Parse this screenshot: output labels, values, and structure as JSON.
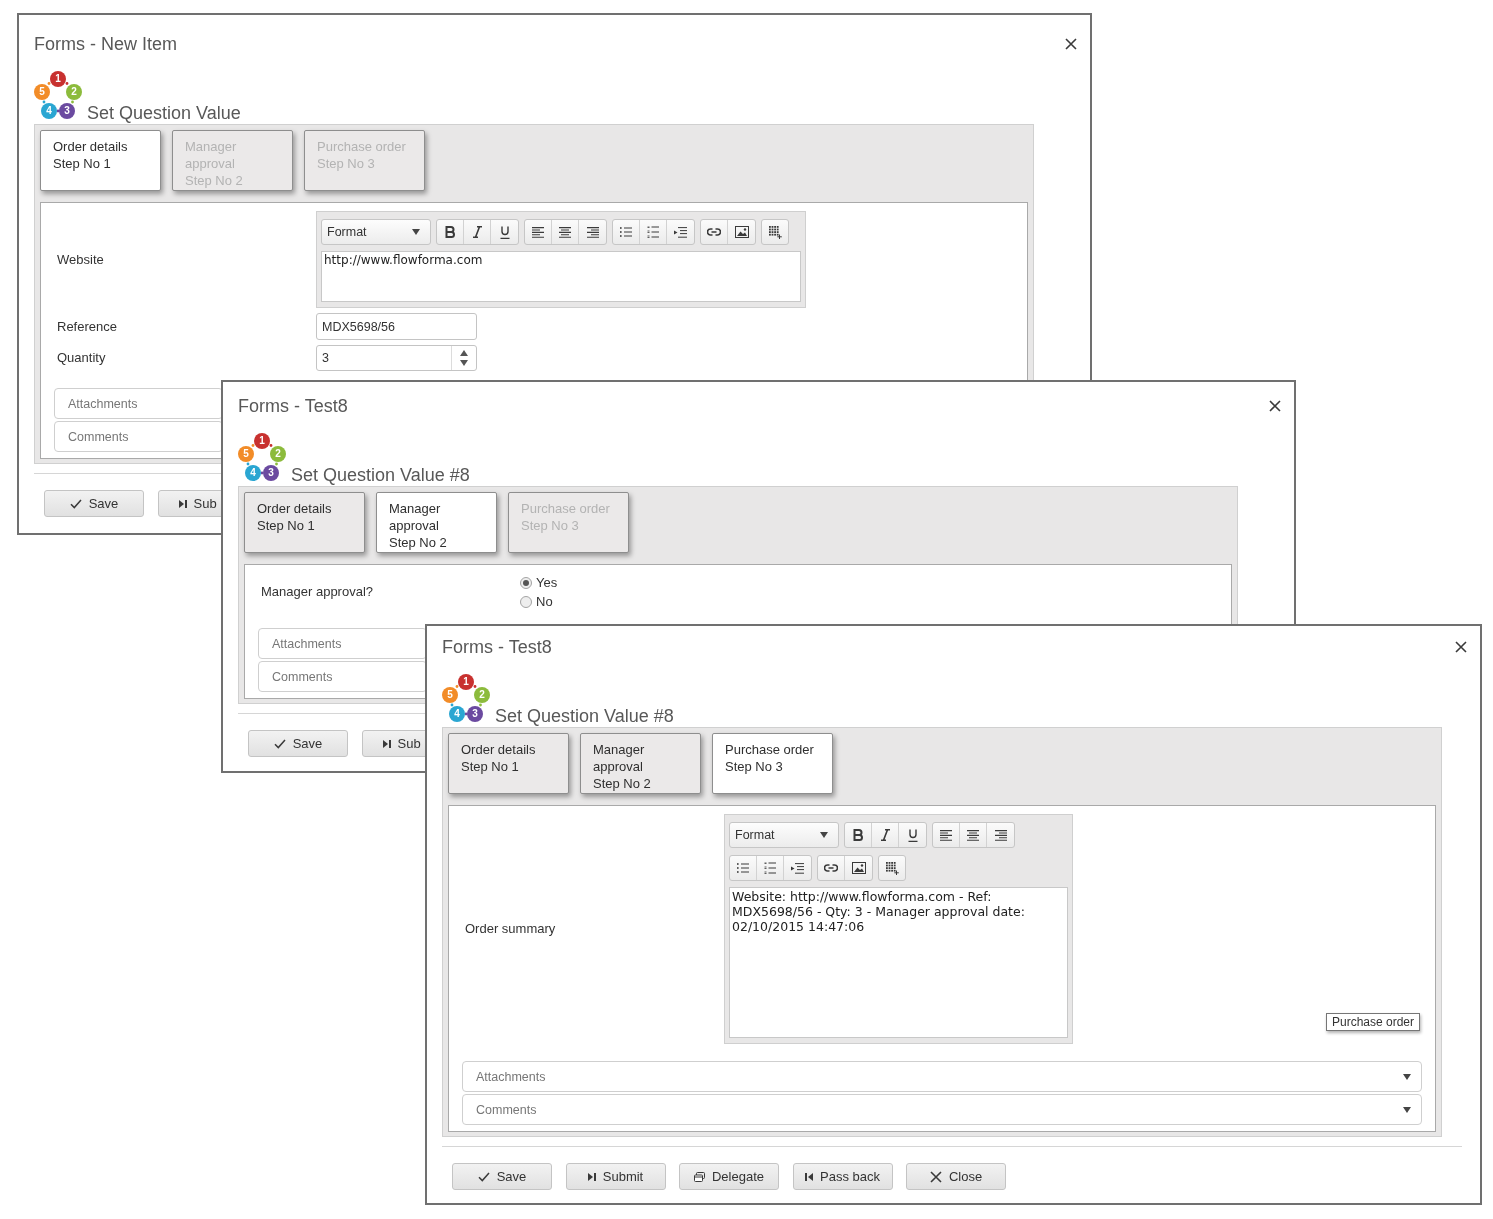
{
  "windows": [
    {
      "title": "Forms - New Item",
      "logo": [
        "1",
        "5",
        "2",
        "4",
        "3"
      ],
      "heading": "Set Question Value",
      "tabs": [
        {
          "label": "Order details",
          "step": "Step No 1",
          "selected": true,
          "disabled": false
        },
        {
          "label": "Manager approval",
          "step": "Step No 2",
          "selected": false,
          "disabled": true
        },
        {
          "label": "Purchase order",
          "step": "Step No 3",
          "selected": false,
          "disabled": true
        }
      ],
      "fields": [
        {
          "kind": "richtext",
          "label": "Website",
          "format": "Format",
          "value": "http://www.flowforma.com"
        },
        {
          "kind": "text",
          "label": "Reference",
          "value": "MDX5698/56"
        },
        {
          "kind": "number",
          "label": "Quantity",
          "value": "3"
        }
      ],
      "sections": [
        "Attachments",
        "Comments"
      ],
      "buttons": [
        {
          "kind": "save",
          "label": "Save"
        },
        {
          "kind": "submit",
          "label": "Sub"
        }
      ]
    },
    {
      "title": "Forms - Test8",
      "logo": [
        "1",
        "5",
        "2",
        "4",
        "3"
      ],
      "heading": "Set Question Value #8",
      "tabs": [
        {
          "label": "Order details",
          "step": "Step No 1",
          "selected": false,
          "disabled": false
        },
        {
          "label": "Manager approval",
          "step": "Step No 2",
          "selected": true,
          "disabled": false
        },
        {
          "label": "Purchase order",
          "step": "Step No 3",
          "selected": false,
          "disabled": true
        }
      ],
      "fields": [
        {
          "kind": "radio",
          "label": "Manager approval?",
          "options": [
            {
              "label": "Yes",
              "selected": true
            },
            {
              "label": "No",
              "selected": false
            }
          ]
        }
      ],
      "sections": [
        "Attachments",
        "Comments"
      ],
      "buttons": [
        {
          "kind": "save",
          "label": "Save"
        },
        {
          "kind": "submit",
          "label": "Sub"
        }
      ]
    },
    {
      "title": "Forms - Test8",
      "logo": [
        "1",
        "5",
        "2",
        "4",
        "3"
      ],
      "heading": "Set Question Value #8",
      "tabs": [
        {
          "label": "Order details",
          "step": "Step No 1",
          "selected": false,
          "disabled": false
        },
        {
          "label": "Manager approval",
          "step": "Step No 2",
          "selected": false,
          "disabled": false
        },
        {
          "label": "Purchase order",
          "step": "Step No 3",
          "selected": true,
          "disabled": false
        }
      ],
      "fields": [
        {
          "kind": "memo",
          "label": "Order summary",
          "format": "Format",
          "value": "Website: http://www.flowforma.com - Ref: MDX5698/56 - Qty: 3 - Manager approval date: 02/10/2015 14:47:06"
        }
      ],
      "tooltip": "Purchase order",
      "sections": [
        "Attachments",
        "Comments"
      ],
      "buttons": [
        {
          "kind": "save",
          "label": "Save"
        },
        {
          "kind": "submit",
          "label": "Submit"
        },
        {
          "kind": "delegate",
          "label": "Delegate"
        },
        {
          "kind": "passback",
          "label": "Pass back"
        },
        {
          "kind": "close",
          "label": "Close"
        }
      ]
    }
  ]
}
